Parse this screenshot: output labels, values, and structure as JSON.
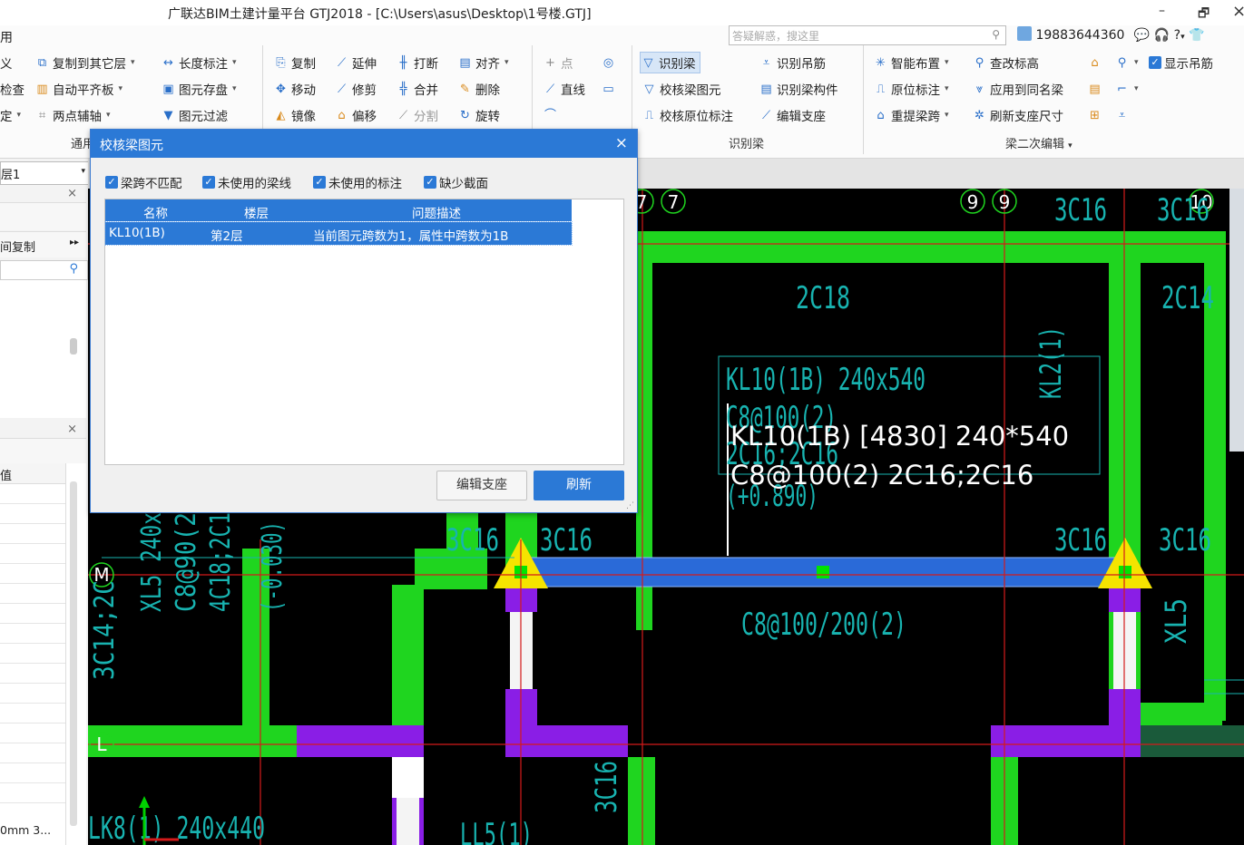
{
  "window": {
    "title": "广联达BIM土建计量平台 GTJ2018 - [C:\\Users\\asus\\Desktop\\1号楼.GTJ]",
    "minimize": "–",
    "restore": "🗗",
    "left_partial": "用"
  },
  "search": {
    "placeholder": "答疑解惑，搜这里"
  },
  "user": {
    "phone": "19883644360",
    "help": "?",
    "dd": "▾"
  },
  "ribbon": {
    "left_partials": [
      "义",
      "检查",
      "定"
    ],
    "general": {
      "copy_to_floor": "复制到其它层",
      "auto_slab": "自动平齐板",
      "two_point_axis": "两点辅轴",
      "length_mark": "长度标注",
      "element_save": "图元存盘",
      "element_filter": "图元过滤",
      "group_label": "通用"
    },
    "modify": {
      "copy": "复制",
      "extend": "延伸",
      "break": "打断",
      "align": "对齐",
      "move": "移动",
      "trim": "修剪",
      "merge": "合并",
      "delete": "删除",
      "mirror": "镜像",
      "offset": "偏移",
      "split": "分割",
      "rotate": "旋转"
    },
    "draw": {
      "point": "点",
      "line": "直线"
    },
    "identify": {
      "identify_beam": "识别梁",
      "check_beam": "校核梁图元",
      "check_original": "校核原位标注",
      "identify_hanger": "识别吊筋",
      "identify_beam_member": "识别梁构件",
      "edit_support": "编辑支座",
      "group_label": "识别梁"
    },
    "secondary": {
      "smart_layout": "智能布置",
      "original_mark": "原位标注",
      "redo_span": "重提梁跨",
      "check_elevation": "查改标高",
      "apply_same": "应用到同名梁",
      "refresh_support": "刷新支座尺寸",
      "show_hanger": "显示吊筋",
      "group_label": "梁二次编辑"
    }
  },
  "left": {
    "floor_select": "层1",
    "copy_between": "间复制",
    "value_header": "值",
    "bottom_text": "0mm 3..."
  },
  "dialog": {
    "title": "校核梁图元",
    "close": "×",
    "checks": [
      {
        "label": "梁跨不匹配",
        "checked": true
      },
      {
        "label": "未使用的梁线",
        "checked": true
      },
      {
        "label": "未使用的标注",
        "checked": true
      },
      {
        "label": "缺少截面",
        "checked": true
      }
    ],
    "columns": {
      "name": "名称",
      "floor": "楼层",
      "desc": "问题描述"
    },
    "rows": [
      {
        "name": "KL10(1B)",
        "floor": "第2层",
        "desc": "当前图元跨数为1，属性中跨数为1B"
      }
    ],
    "buttons": {
      "edit_support": "编辑支座",
      "refresh": "刷新"
    }
  },
  "canvas": {
    "beam_label_line1": "KL10(1B) [4830] 240*540",
    "beam_label_line2": "C8@100(2) 2C16;2C16",
    "axis": {
      "a7a": "7",
      "a7b": "7",
      "a9a": "9",
      "a9b": "9",
      "a10": "10",
      "M": "M",
      "L": "L"
    },
    "cad_texts": {
      "kl10": "KL10(1B) 240x540",
      "kl10_stirrup": "C8@100(2)",
      "kl10_bars": "2C16;2C16",
      "kl10_elev": "(+0.890)",
      "c2c18": "2C18",
      "c2c14": "2C14",
      "c3c16_top1": "3C16",
      "c3c16_top2": "3C16",
      "c3c16_mid1": "3C16",
      "c3c16_mid2": "3C16",
      "c3c16_mid3": "3C16",
      "c3c16_mid4": "3C16",
      "c3c16_vert": "3C16",
      "stirrup_lower": "C8@100/200(2)",
      "kl2": "KL2(1)",
      "xl5": "XL5",
      "ll5": "LL5(1)",
      "lk8": "LK8(1) 240x440",
      "left_v1": "XL5 240x",
      "left_v2": "C8@90(2",
      "left_v3": "4C18;2C1",
      "left_v4": "3C14;2C",
      "left_v5": "(-0.030)"
    }
  },
  "colors": {
    "accent": "#2b79d6",
    "beam_green": "#1fd51f",
    "wall_purple": "#8a1ee6",
    "selected_beam": "#2a6ad8",
    "support_yellow": "#f5e400",
    "cad_text": "#18b3b0",
    "grid_red": "#d41a1a"
  }
}
